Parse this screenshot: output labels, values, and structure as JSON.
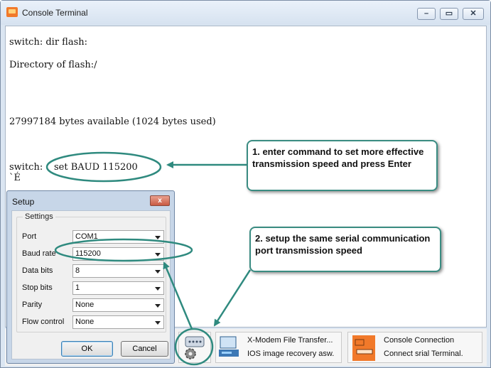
{
  "window": {
    "title": "Console Terminal",
    "controls": {
      "minimize": "–",
      "maximize": "▭",
      "close": "✕"
    }
  },
  "console": {
    "lines": [
      "switch: dir flash:",
      "Directory of flash:/",
      "27997184 bytes available (1024 bytes used)",
      "switch:",
      "set BAUD 115200",
      "`É"
    ]
  },
  "setup_dialog": {
    "title": "Setup",
    "close_glyph": "x",
    "group_label": "Settings",
    "fields": [
      {
        "label": "Port",
        "value": "COM1"
      },
      {
        "label": "Baud rate",
        "value": "115200"
      },
      {
        "label": "Data bits",
        "value": "8"
      },
      {
        "label": "Stop bits",
        "value": "1"
      },
      {
        "label": "Parity",
        "value": "None"
      },
      {
        "label": "Flow control",
        "value": "None"
      }
    ],
    "ok_label": "OK",
    "cancel_label": "Cancel"
  },
  "toolbar": {
    "xmodem": {
      "title": "X-Modem File Transfer...",
      "subtitle": "IOS image  recovery asw."
    },
    "console_connection": {
      "title": "Console Connection",
      "subtitle": "Connect srial Terminal."
    }
  },
  "annotations": {
    "callout1": "1. enter command to set more effective transmission speed and press Enter",
    "callout2": "2. setup the same serial communication port transmission speed"
  },
  "colors": {
    "annotation_teal": "#2f8a7f",
    "accent_orange": "#f1792a"
  }
}
